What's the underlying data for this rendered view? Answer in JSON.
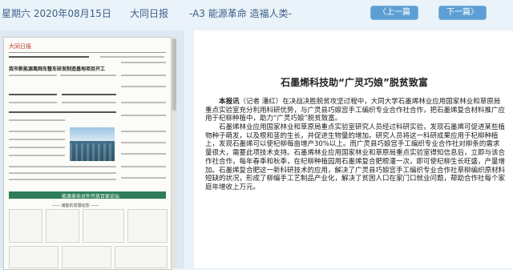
{
  "header": {
    "date": "星期六 2020年08月15日",
    "paper_name": "大同日报",
    "section": "-A3 能源革命 造福人类-",
    "prev_label": "〈上一篇",
    "next_label": "下一篇〉"
  },
  "thumbnail": {
    "headline": "我市新能源离网车整车研发制造基地项目开工",
    "forum_title": "能源革命对外开放百家论坛",
    "forum_subtitle": "—— 储能的发展动态 ——"
  },
  "article": {
    "title": "石墨烯科技助“广灵巧娘”脱贫致富",
    "lead_label": "本报讯",
    "lead_text": "（记者 潘红）在决战决胜脱贫攻坚过程中，大同大学石墨烯林业应用国家林业和草原局重点实验室充分利用科研优势，与广灵县巧娘宫手工编织专业合作社合作，把石墨烯复合材料推广应用于杞柳种植中，助力“广灵巧娘”脱贫致富。",
    "body": "石墨烯林业应用国家林业和草原局重点实验室研究人员经过科研实验，发现石墨烯可促进某些植物种子萌发，以及根和茎的生长，并促进生物量的增加。研究人员将这一科研成果应用于杞柳种植上，发现石墨烯可以使杞柳每亩增产30%以上。而广灵县巧娘宫手工编织专业合作社对柳条的需求量很大，需要此项技术支持。石墨烯林业应用国家林业和草原局重点实验室得知信息后，立即与该合作社合作，每年春季和秋季，在杞柳种植园用石墨烯复合肥根灌一次，即可使杞柳生长旺盛，产量增加。石墨烯复合肥这一新科研技术的应用，解决了广灵县巧娘宫手工编织专业合作社草柳编织原材料短缺的状况，形成了柳编手工艺制品产业化，解决了贫困人口在家门口就业问题，帮助合作社每个家庭年增收上万元。"
  },
  "colors": {
    "accent": "#5d9fd4",
    "header_text": "#3d5f87",
    "background": "#e9f2f8",
    "forum_band": "#2f7d59"
  }
}
